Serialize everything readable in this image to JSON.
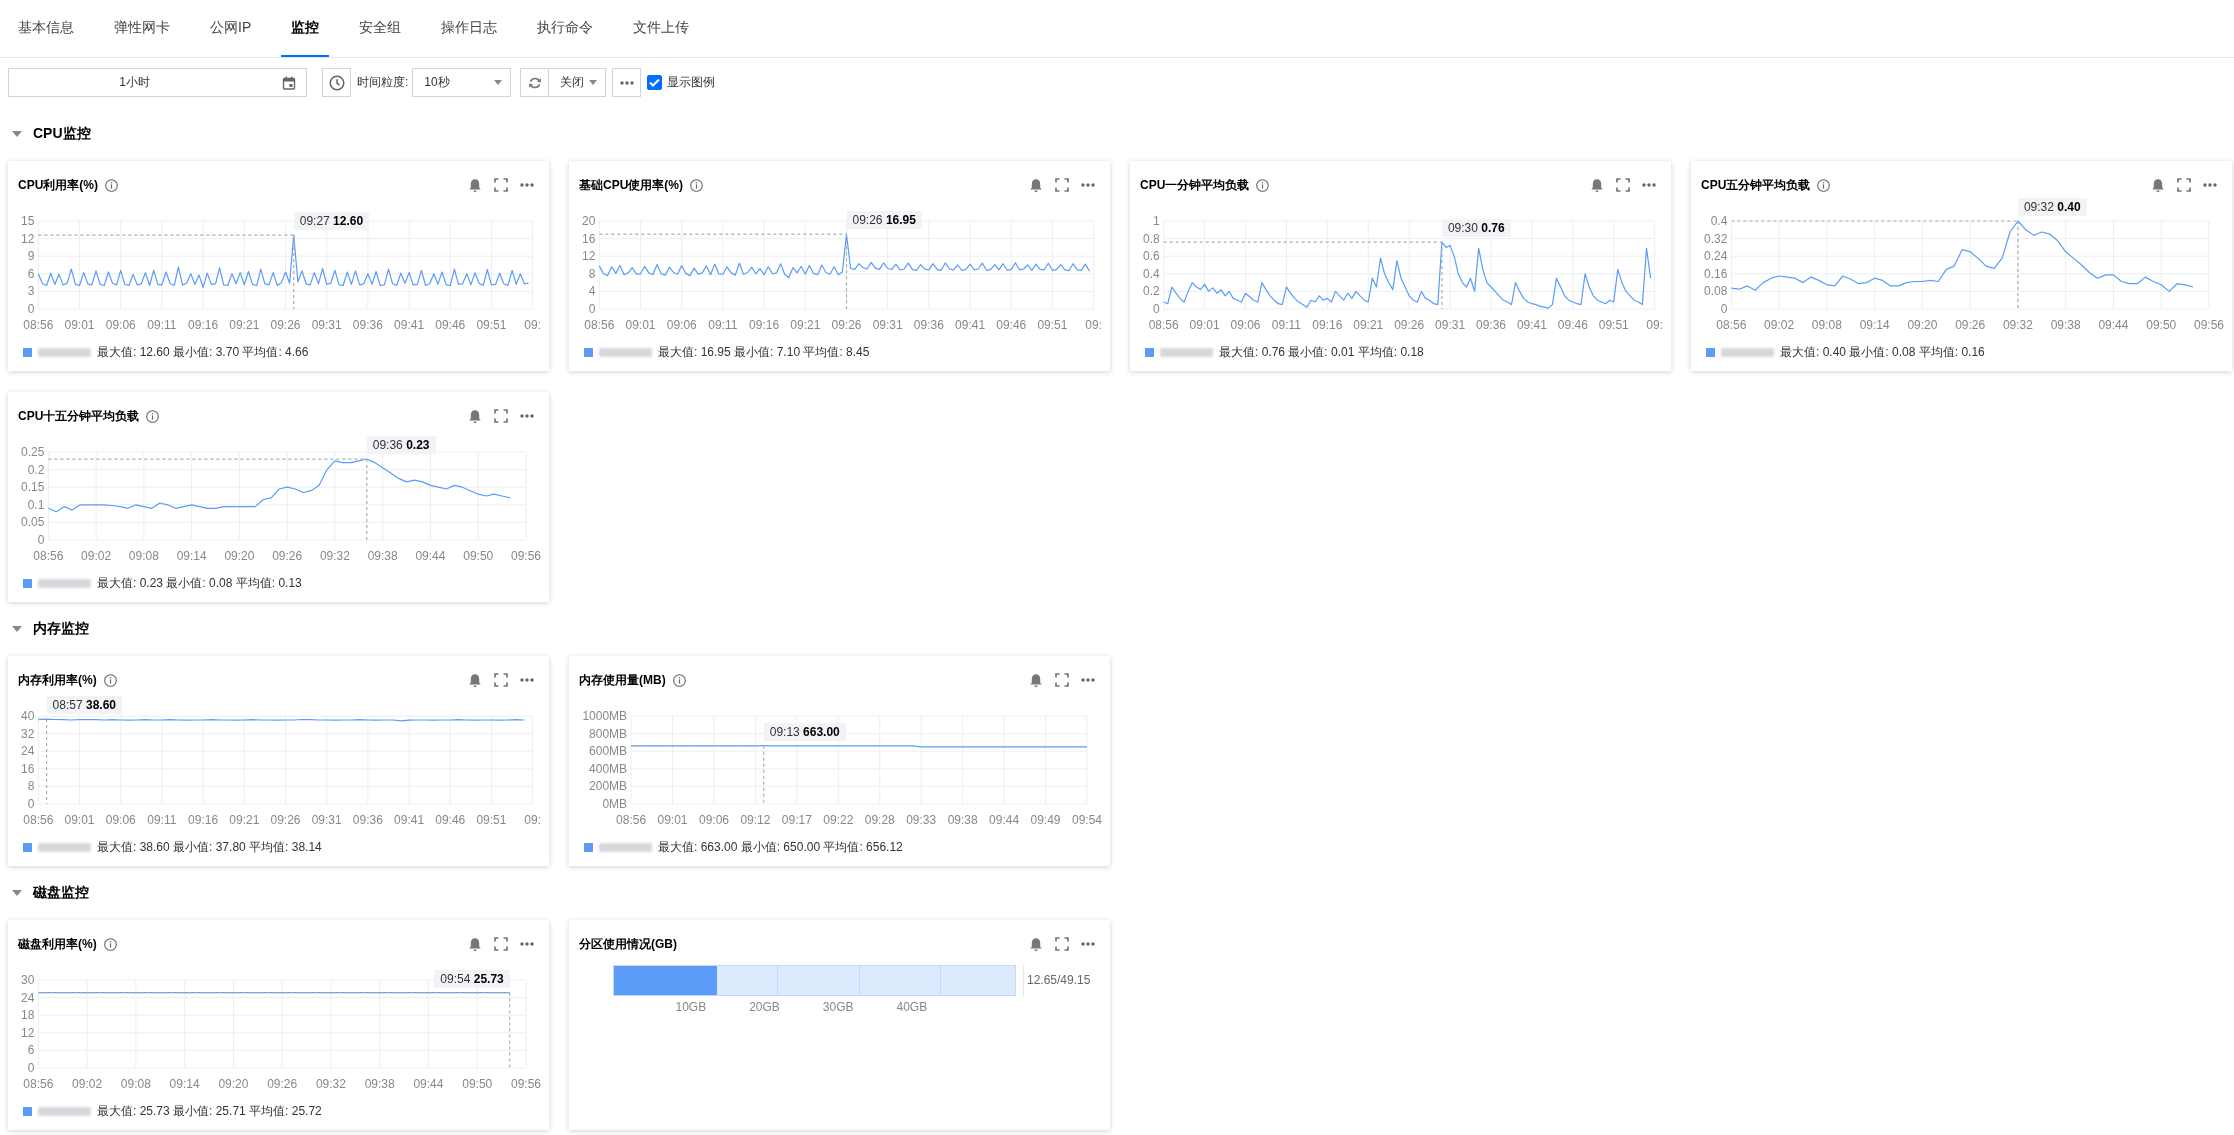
{
  "tabs": [
    {
      "label": "基本信息",
      "selected": false
    },
    {
      "label": "弹性网卡",
      "selected": false
    },
    {
      "label": "公网IP",
      "selected": false
    },
    {
      "label": "监控",
      "selected": true
    },
    {
      "label": "安全组",
      "selected": false
    },
    {
      "label": "操作日志",
      "selected": false
    },
    {
      "label": "执行命令",
      "selected": false
    },
    {
      "label": "文件上传",
      "selected": false
    }
  ],
  "toolbar": {
    "time_range": "1小时",
    "granularity_label": "时间粒度:",
    "granularity": "10秒",
    "auto_refresh": "关闭",
    "show_legend": {
      "label": "显示图例",
      "checked": true
    }
  },
  "sections": [
    {
      "title": "CPU监控",
      "expanded": true,
      "cards": [
        {
          "title": "CPU利用率(%)",
          "info": true,
          "x_cut_label": "09:",
          "legend_stats": "最大值: 12.60 最小值: 3.70 平均值: 4.66",
          "chart_data": {
            "type": "line",
            "grid": true,
            "categories": [
              "08:56",
              null,
              null,
              null,
              null,
              null,
              null,
              null,
              null,
              null,
              "09:01",
              null,
              null,
              null,
              null,
              null,
              null,
              null,
              null,
              null,
              "09:06",
              null,
              null,
              null,
              null,
              null,
              null,
              null,
              null,
              null,
              "09:11",
              null,
              null,
              null,
              null,
              null,
              null,
              null,
              null,
              null,
              "09:16",
              null,
              null,
              null,
              null,
              null,
              null,
              null,
              null,
              null,
              "09:21",
              null,
              null,
              null,
              null,
              null,
              null,
              null,
              null,
              null,
              "09:26",
              null,
              null,
              null,
              null,
              null,
              null,
              null,
              null,
              null,
              "09:31",
              null,
              null,
              null,
              null,
              null,
              null,
              null,
              null,
              null,
              "09:36",
              null,
              null,
              null,
              null,
              null,
              null,
              null,
              null,
              null,
              "09:41",
              null,
              null,
              null,
              null,
              null,
              null,
              null,
              null,
              null,
              "09:46",
              null,
              null,
              null,
              null,
              null,
              null,
              null,
              null,
              null,
              "09:51",
              null,
              null,
              null,
              null,
              null,
              null,
              null,
              null,
              null,
              null
            ],
            "ylim": [
              0,
              15
            ],
            "yticks": [
              0,
              3,
              6,
              9,
              12,
              15
            ],
            "series": [
              {
                "color": "#5b9cf8",
                "values": [
                  6.0,
                  4.3,
                  4.0,
                  6.1,
                  4.2,
                  5.9,
                  4.1,
                  4.4,
                  6.8,
                  4.2,
                  4.0,
                  6.2,
                  4.3,
                  4.1,
                  6.5,
                  4.2,
                  4.0,
                  6.3,
                  4.4,
                  4.1,
                  6.6,
                  4.2,
                  4.0,
                  5.9,
                  4.1,
                  4.3,
                  6.2,
                  4.0,
                  6.6,
                  4.2,
                  4.1,
                  6.3,
                  4.3,
                  4.0,
                  7.2,
                  4.1,
                  4.4,
                  6.0,
                  4.2,
                  5.8,
                  3.7,
                  6.1,
                  4.2,
                  4.3,
                  7.0,
                  4.1,
                  4.0,
                  6.0,
                  4.3,
                  6.2,
                  4.1,
                  6.4,
                  4.2,
                  4.0,
                  6.8,
                  4.3,
                  4.1,
                  6.2,
                  4.0,
                  4.5,
                  6.3,
                  4.4,
                  12.6,
                  4.6,
                  6.5,
                  4.3,
                  4.1,
                  6.2,
                  4.3,
                  6.9,
                  4.2,
                  4.4,
                  6.6,
                  4.1,
                  4.0,
                  6.3,
                  4.2,
                  6.5,
                  4.1,
                  4.3,
                  6.0,
                  4.2,
                  6.4,
                  4.0,
                  4.1,
                  6.8,
                  4.3,
                  4.0,
                  6.1,
                  4.4,
                  6.2,
                  4.1,
                  4.2,
                  6.6,
                  4.0,
                  4.3,
                  6.0,
                  4.2,
                  6.3,
                  4.1,
                  4.0,
                  6.8,
                  4.2,
                  4.3,
                  6.0,
                  4.1,
                  6.2,
                  4.4,
                  4.0,
                  6.7,
                  4.1,
                  4.2,
                  6.1,
                  4.3,
                  4.0,
                  6.6,
                  4.2,
                  6.0,
                  4.3,
                  4.4,
                  null
                ]
              }
            ],
            "annotations": [
              "09:27 **12.60**"
            ]
          }
        },
        {
          "title": "基础CPU使用率(%)",
          "info": true,
          "x_cut_label": "09:",
          "legend_stats": "最大值: 16.95 最小值: 7.10 平均值: 8.45",
          "chart_data": {
            "type": "line",
            "grid": true,
            "categories": [
              "08:56",
              null,
              null,
              null,
              null,
              null,
              null,
              null,
              null,
              null,
              "09:01",
              null,
              null,
              null,
              null,
              null,
              null,
              null,
              null,
              null,
              "09:06",
              null,
              null,
              null,
              null,
              null,
              null,
              null,
              null,
              null,
              "09:11",
              null,
              null,
              null,
              null,
              null,
              null,
              null,
              null,
              null,
              "09:16",
              null,
              null,
              null,
              null,
              null,
              null,
              null,
              null,
              null,
              "09:21",
              null,
              null,
              null,
              null,
              null,
              null,
              null,
              null,
              null,
              "09:26",
              null,
              null,
              null,
              null,
              null,
              null,
              null,
              null,
              null,
              "09:31",
              null,
              null,
              null,
              null,
              null,
              null,
              null,
              null,
              null,
              "09:36",
              null,
              null,
              null,
              null,
              null,
              null,
              null,
              null,
              null,
              "09:41",
              null,
              null,
              null,
              null,
              null,
              null,
              null,
              null,
              null,
              "09:46",
              null,
              null,
              null,
              null,
              null,
              null,
              null,
              null,
              null,
              "09:51",
              null,
              null,
              null,
              null,
              null,
              null,
              null,
              null,
              null,
              null
            ],
            "ylim": [
              0,
              20
            ],
            "yticks": [
              0,
              4,
              8,
              12,
              16,
              20
            ],
            "series": [
              {
                "color": "#5b9cf8",
                "values": [
                  9.8,
                  8.0,
                  7.6,
                  9.6,
                  8.1,
                  9.9,
                  7.8,
                  8.2,
                  9.4,
                  7.9,
                  8.0,
                  9.7,
                  8.2,
                  7.8,
                  10.1,
                  8.0,
                  7.7,
                  9.5,
                  8.3,
                  7.9,
                  9.9,
                  8.1,
                  7.6,
                  9.3,
                  7.9,
                  8.2,
                  9.8,
                  7.8,
                  10.2,
                  8.0,
                  7.9,
                  9.6,
                  8.2,
                  7.7,
                  10.4,
                  7.9,
                  8.3,
                  9.5,
                  8.0,
                  9.2,
                  7.8,
                  9.6,
                  8.0,
                  8.2,
                  10.3,
                  7.9,
                  7.1,
                  9.4,
                  8.2,
                  9.7,
                  7.9,
                  9.9,
                  8.1,
                  7.8,
                  10.0,
                  8.3,
                  7.9,
                  9.6,
                  7.8,
                  8.4,
                  17.0,
                  9.2,
                  9.0,
                  10.3,
                  9.4,
                  9.1,
                  10.6,
                  9.3,
                  9.0,
                  10.5,
                  9.2,
                  9.0,
                  10.2,
                  8.9,
                  9.1,
                  10.4,
                  9.0,
                  8.8,
                  10.1,
                  9.1,
                  8.9,
                  10.3,
                  9.0,
                  8.8,
                  10.5,
                  9.1,
                  8.9,
                  10.0,
                  8.8,
                  9.0,
                  10.2,
                  8.9,
                  9.1,
                  10.4,
                  8.8,
                  9.0,
                  10.1,
                  8.9,
                  10.3,
                  8.8,
                  9.0,
                  10.5,
                  8.9,
                  9.1,
                  10.0,
                  8.8,
                  10.2,
                  9.0,
                  8.9,
                  10.4,
                  8.8,
                  9.0,
                  10.1,
                  8.9,
                  8.7,
                  10.3,
                  8.9,
                  8.8,
                  10.2,
                  8.6,
                  null
                ]
              }
            ],
            "annotations": [
              "09:26 **16.95**"
            ]
          }
        },
        {
          "title": "CPU一分钟平均负载",
          "info": true,
          "x_cut_label": "09:",
          "legend_stats": "最大值: 0.76 最小值: 0.01 平均值: 0.18",
          "chart_data": {
            "type": "line",
            "grid": true,
            "categories": [
              "08:56",
              null,
              null,
              null,
              null,
              null,
              null,
              null,
              null,
              null,
              "09:01",
              null,
              null,
              null,
              null,
              null,
              null,
              null,
              null,
              null,
              "09:06",
              null,
              null,
              null,
              null,
              null,
              null,
              null,
              null,
              null,
              "09:11",
              null,
              null,
              null,
              null,
              null,
              null,
              null,
              null,
              null,
              "09:16",
              null,
              null,
              null,
              null,
              null,
              null,
              null,
              null,
              null,
              "09:21",
              null,
              null,
              null,
              null,
              null,
              null,
              null,
              null,
              null,
              "09:26",
              null,
              null,
              null,
              null,
              null,
              null,
              null,
              null,
              null,
              "09:31",
              null,
              null,
              null,
              null,
              null,
              null,
              null,
              null,
              null,
              "09:36",
              null,
              null,
              null,
              null,
              null,
              null,
              null,
              null,
              null,
              "09:41",
              null,
              null,
              null,
              null,
              null,
              null,
              null,
              null,
              null,
              "09:46",
              null,
              null,
              null,
              null,
              null,
              null,
              null,
              null,
              null,
              "09:51",
              null,
              null,
              null,
              null,
              null,
              null,
              null,
              null,
              null,
              null
            ],
            "ylim": [
              0,
              1
            ],
            "yticks": [
              0,
              0.2,
              0.4,
              0.6,
              0.8,
              1
            ],
            "series": [
              {
                "color": "#5b9cf8",
                "values": [
                  0.08,
                  0.06,
                  0.25,
                  0.18,
                  0.12,
                  0.08,
                  0.2,
                  0.3,
                  0.25,
                  0.22,
                  0.28,
                  0.2,
                  0.24,
                  0.18,
                  0.22,
                  0.15,
                  0.2,
                  0.12,
                  0.1,
                  0.08,
                  0.18,
                  0.14,
                  0.1,
                  0.08,
                  0.3,
                  0.22,
                  0.15,
                  0.1,
                  0.06,
                  0.05,
                  0.25,
                  0.18,
                  0.12,
                  0.08,
                  0.05,
                  0.02,
                  0.1,
                  0.08,
                  0.15,
                  0.1,
                  0.12,
                  0.08,
                  0.2,
                  0.15,
                  0.1,
                  0.18,
                  0.12,
                  0.2,
                  0.15,
                  0.1,
                  0.08,
                  0.35,
                  0.25,
                  0.58,
                  0.4,
                  0.3,
                  0.22,
                  0.55,
                  0.35,
                  0.25,
                  0.15,
                  0.1,
                  0.08,
                  0.2,
                  0.12,
                  0.1,
                  0.06,
                  0.05,
                  0.76,
                  0.7,
                  0.72,
                  0.6,
                  0.4,
                  0.3,
                  0.25,
                  0.35,
                  0.2,
                  0.69,
                  0.45,
                  0.3,
                  0.25,
                  0.2,
                  0.15,
                  0.1,
                  0.08,
                  0.05,
                  0.3,
                  0.2,
                  0.12,
                  0.08,
                  0.06,
                  0.05,
                  0.03,
                  0.02,
                  0.01,
                  0.05,
                  0.35,
                  0.25,
                  0.15,
                  0.1,
                  0.08,
                  0.06,
                  0.05,
                  0.4,
                  0.25,
                  0.15,
                  0.1,
                  0.08,
                  0.06,
                  0.1,
                  0.08,
                  0.45,
                  0.3,
                  0.2,
                  0.15,
                  0.1,
                  0.08,
                  0.05,
                  0.69,
                  0.35,
                  null
                ]
              }
            ],
            "annotations": [
              "09:30 **0.76**"
            ]
          }
        },
        {
          "title": "CPU五分钟平均负载",
          "info": true,
          "legend_stats": "最大值: 0.40 最小值: 0.08 平均值: 0.16",
          "chart_data": {
            "type": "line",
            "grid": true,
            "categories": [
              "08:56",
              null,
              null,
              null,
              null,
              null,
              "09:02",
              null,
              null,
              null,
              null,
              null,
              "09:08",
              null,
              null,
              null,
              null,
              null,
              "09:14",
              null,
              null,
              null,
              null,
              null,
              "09:20",
              null,
              null,
              null,
              null,
              null,
              "09:26",
              null,
              null,
              null,
              null,
              null,
              "09:32",
              null,
              null,
              null,
              null,
              null,
              "09:38",
              null,
              null,
              null,
              null,
              null,
              "09:44",
              null,
              null,
              null,
              null,
              null,
              "09:50",
              null,
              null,
              null,
              null,
              null,
              "09:56"
            ],
            "ylim": [
              0,
              0.4
            ],
            "yticks": [
              0,
              0.08,
              0.16,
              0.24,
              0.32,
              0.4
            ],
            "series": [
              {
                "color": "#5b9cf8",
                "values": [
                  0.095,
                  0.09,
                  0.105,
                  0.085,
                  0.12,
                  0.14,
                  0.15,
                  0.145,
                  0.14,
                  0.12,
                  0.145,
                  0.13,
                  0.11,
                  0.105,
                  0.15,
                  0.135,
                  0.115,
                  0.12,
                  0.14,
                  0.13,
                  0.105,
                  0.105,
                  0.12,
                  0.125,
                  0.125,
                  0.13,
                  0.125,
                  0.18,
                  0.195,
                  0.27,
                  0.26,
                  0.23,
                  0.195,
                  0.185,
                  0.23,
                  0.35,
                  0.4,
                  0.36,
                  0.335,
                  0.35,
                  0.34,
                  0.31,
                  0.26,
                  0.23,
                  0.2,
                  0.165,
                  0.14,
                  0.155,
                  0.155,
                  0.125,
                  0.115,
                  0.115,
                  0.145,
                  0.125,
                  0.11,
                  0.08,
                  0.115,
                  0.11,
                  0.1,
                  null,
                  null
                ]
              }
            ],
            "annotations": [
              "09:32 **0.40**"
            ]
          }
        },
        {
          "title": "CPU十五分钟平均负载",
          "info": true,
          "legend_stats": "最大值: 0.23 最小值: 0.08 平均值: 0.13",
          "chart_data": {
            "type": "line",
            "grid": true,
            "categories": [
              "08:56",
              null,
              null,
              null,
              null,
              null,
              "09:02",
              null,
              null,
              null,
              null,
              null,
              "09:08",
              null,
              null,
              null,
              null,
              null,
              "09:14",
              null,
              null,
              null,
              null,
              null,
              "09:20",
              null,
              null,
              null,
              null,
              null,
              "09:26",
              null,
              null,
              null,
              null,
              null,
              "09:32",
              null,
              null,
              null,
              null,
              null,
              "09:38",
              null,
              null,
              null,
              null,
              null,
              "09:44",
              null,
              null,
              null,
              null,
              null,
              "09:50",
              null,
              null,
              null,
              null,
              null,
              "09:56"
            ],
            "ylim": [
              0,
              0.25
            ],
            "yticks": [
              0,
              0.05,
              0.1,
              0.15,
              0.2,
              0.25
            ],
            "series": [
              {
                "color": "#5b9cf8",
                "values": [
                  0.09,
                  0.08,
                  0.095,
                  0.085,
                  0.1,
                  0.1,
                  0.1,
                  0.1,
                  0.098,
                  0.095,
                  0.09,
                  0.1,
                  0.095,
                  0.09,
                  0.105,
                  0.1,
                  0.09,
                  0.095,
                  0.1,
                  0.095,
                  0.09,
                  0.09,
                  0.095,
                  0.095,
                  0.095,
                  0.095,
                  0.095,
                  0.115,
                  0.12,
                  0.145,
                  0.15,
                  0.145,
                  0.135,
                  0.14,
                  0.155,
                  0.2,
                  0.225,
                  0.22,
                  0.22,
                  0.225,
                  0.23,
                  0.22,
                  0.205,
                  0.19,
                  0.175,
                  0.165,
                  0.17,
                  0.165,
                  0.155,
                  0.15,
                  0.145,
                  0.155,
                  0.15,
                  0.14,
                  0.13,
                  0.125,
                  0.13,
                  0.125,
                  0.12,
                  null,
                  null
                ]
              }
            ],
            "annotations": [
              "09:36 **0.23**"
            ]
          }
        }
      ]
    },
    {
      "title": "内存监控",
      "expanded": true,
      "cards": [
        {
          "title": "内存利用率(%)",
          "info": true,
          "x_cut_label": "09:",
          "legend_stats": "最大值: 38.60 最小值: 37.80 平均值: 38.14",
          "chart_data": {
            "type": "line",
            "grid": true,
            "categories": [
              "08:56",
              null,
              null,
              null,
              null,
              "09:01",
              null,
              null,
              null,
              null,
              "09:06",
              null,
              null,
              null,
              null,
              "09:11",
              null,
              null,
              null,
              null,
              "09:16",
              null,
              null,
              null,
              null,
              "09:21",
              null,
              null,
              null,
              null,
              "09:26",
              null,
              null,
              null,
              null,
              "09:31",
              null,
              null,
              null,
              null,
              "09:36",
              null,
              null,
              null,
              null,
              "09:41",
              null,
              null,
              null,
              null,
              "09:46",
              null,
              null,
              null,
              null,
              "09:51",
              null,
              null,
              null,
              null,
              null
            ],
            "ylim": [
              0,
              40
            ],
            "yticks": [
              0,
              8,
              16,
              24,
              32,
              40
            ],
            "series": [
              {
                "color": "#5b9cf8",
                "values": [
                  38.3,
                  38.6,
                  38.4,
                  38.3,
                  38.2,
                  38.3,
                  38.4,
                  38.3,
                  38.2,
                  38.3,
                  38.2,
                  38.1,
                  38.2,
                  38.3,
                  38.2,
                  38.2,
                  38.3,
                  38.2,
                  38.1,
                  38.2,
                  38.2,
                  38.3,
                  38.2,
                  38.2,
                  38.1,
                  38.2,
                  38.3,
                  38.2,
                  38.2,
                  38.1,
                  38.2,
                  38.2,
                  38.4,
                  38.3,
                  38.2,
                  38.2,
                  38.1,
                  38.2,
                  38.2,
                  38.3,
                  38.2,
                  38.1,
                  38.2,
                  38.2,
                  37.8,
                  38.1,
                  38.2,
                  38.2,
                  38.1,
                  38.2,
                  38.2,
                  38.3,
                  38.2,
                  38.1,
                  38.2,
                  38.2,
                  38.1,
                  38.2,
                  38.3,
                  38.2,
                  null
                ]
              }
            ],
            "annotations": [
              "08:57 **38.60**"
            ]
          }
        },
        {
          "title": "内存使用量(MB)",
          "info": true,
          "legend_stats": "最大值: 663.00 最小值: 650.00 平均值: 656.12",
          "chart_data": {
            "type": "line",
            "grid": true,
            "categories": [
              "08:56",
              null,
              null,
              null,
              null,
              "09:01",
              null,
              null,
              null,
              null,
              "09:06",
              null,
              null,
              null,
              null,
              "09:12",
              null,
              null,
              null,
              null,
              "09:17",
              null,
              null,
              null,
              null,
              "09:22",
              null,
              null,
              null,
              null,
              "09:28",
              null,
              null,
              null,
              null,
              "09:33",
              null,
              null,
              null,
              null,
              "09:38",
              null,
              null,
              null,
              null,
              "09:44",
              null,
              null,
              null,
              null,
              "09:49",
              null,
              null,
              null,
              null,
              "09:54"
            ],
            "ylim": [
              0,
              1000
            ],
            "yticks": [
              {
                "value": 0,
                "label": "0MB"
              },
              {
                "value": 200,
                "label": "200MB"
              },
              {
                "value": 400,
                "label": "400MB"
              },
              {
                "value": 600,
                "label": "600MB"
              },
              {
                "value": 800,
                "label": "800MB"
              },
              {
                "value": 1000,
                "label": "1000MB"
              }
            ],
            "series": [
              {
                "color": "#5b9cf8",
                "values": [
                  660,
                  660,
                  660,
                  660,
                  660,
                  660,
                  660,
                  660,
                  660,
                  660,
                  660,
                  660,
                  660,
                  660,
                  660,
                  660,
                  663,
                  660,
                  660,
                  660,
                  660,
                  660,
                  660,
                  660,
                  660,
                  660,
                  660,
                  660,
                  660,
                  660,
                  660,
                  660,
                  660,
                  660,
                  660,
                  650,
                  650,
                  650,
                  650,
                  650,
                  650,
                  650,
                  650,
                  650,
                  650,
                  650,
                  650,
                  650,
                  650,
                  650,
                  650,
                  650,
                  650,
                  650,
                  650,
                  650
                ]
              }
            ],
            "annotations": [
              "09:13 **663.00**"
            ]
          }
        }
      ]
    },
    {
      "title": "磁盘监控",
      "expanded": true,
      "cards": [
        {
          "title": "磁盘利用率(%)",
          "info": true,
          "legend_stats": "最大值: 25.73 最小值: 25.71 平均值: 25.72",
          "chart_data": {
            "type": "line",
            "grid": true,
            "categories": [
              "08:56",
              null,
              null,
              "09:02",
              null,
              null,
              "09:08",
              null,
              null,
              "09:14",
              null,
              null,
              "09:20",
              null,
              null,
              "09:26",
              null,
              null,
              "09:32",
              null,
              null,
              "09:38",
              null,
              null,
              "09:44",
              null,
              null,
              "09:50",
              null,
              null,
              "09:56"
            ],
            "ylim": [
              0,
              30
            ],
            "yticks": [
              0,
              6,
              12,
              18,
              24,
              30
            ],
            "series": [
              {
                "color": "#5b9cf8",
                "values": [
                  25.7,
                  25.7,
                  25.7,
                  25.7,
                  25.7,
                  25.7,
                  25.7,
                  25.7,
                  25.7,
                  25.7,
                  25.7,
                  25.7,
                  25.7,
                  25.7,
                  25.7,
                  25.7,
                  25.7,
                  25.7,
                  25.7,
                  25.7,
                  25.7,
                  25.7,
                  25.7,
                  25.7,
                  25.7,
                  25.7,
                  25.7,
                  25.7,
                  25.7,
                  25.7,
                  null
                ]
              }
            ],
            "annotations": [
              "09:54 **25.73**"
            ]
          }
        },
        {
          "title": "分区使用情况(GB)",
          "info": false,
          "usage": {
            "level": 0.257,
            "reading": "12.65/49.15",
            "scale": [
              "10GB",
              "20GB",
              "30GB",
              "40GB"
            ]
          }
        }
      ]
    }
  ]
}
